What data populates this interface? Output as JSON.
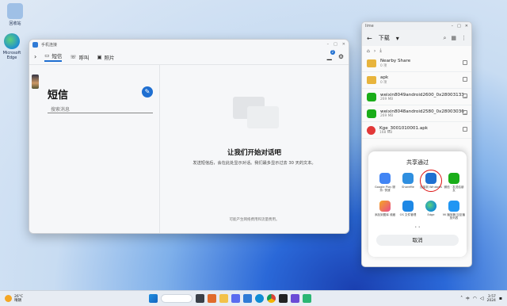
{
  "desktop": {
    "icons": [
      {
        "label": "回收站",
        "color": "#7da7d9"
      },
      {
        "label": "Microsoft Edge",
        "color": "#1f8fd0"
      }
    ]
  },
  "phone_link": {
    "title": "手机连接",
    "tabs": [
      {
        "label": "短信",
        "icon": "message-icon"
      },
      {
        "label": "呼叫",
        "icon": "phone-icon"
      },
      {
        "label": "照片",
        "icon": "photo-icon"
      }
    ],
    "badge_count": "2",
    "messages_title": "短信",
    "compose_icon": "compose-icon",
    "search_placeholder": "搜索消息",
    "empty_title": "让我们开始对话吧",
    "empty_desc": "发送短信后，会在此处显示对话。我们最多显示过去 30 天的文本。",
    "footer_note": "可能产生网络费用和流量费用。"
  },
  "file_manager": {
    "window_title": "lime",
    "folder": "下载",
    "items": [
      {
        "name": "Nearby Share",
        "meta": "0 项",
        "type": "folder"
      },
      {
        "name": "apk",
        "meta": "0 项",
        "type": "folder"
      },
      {
        "name": "weixin8049android2600_0x28003133_arm64.apk",
        "meta": "269 MB",
        "type": "wechat"
      },
      {
        "name": "weixin8048android2580_0x28003036_arm64.apk",
        "meta": "269 MB",
        "type": "wechat"
      },
      {
        "name": "Kge_3001010001.apk",
        "meta": "168 MB",
        "type": "kge"
      }
    ]
  },
  "share_sheet": {
    "title": "共享通过",
    "apps": [
      {
        "label": "Google Play 服务: 快速",
        "color": "#4285f4"
      },
      {
        "label": "ShareMe",
        "color": "#2f8fe0"
      },
      {
        "label": "连接到 Windows",
        "color": "#1f6fd1"
      },
      {
        "label": "微信 · 发送给朋友",
        "color": "#1aad19"
      },
      {
        "label": "添加到图库 收藏",
        "color": "#f5a623"
      },
      {
        "label": "OS 文件管理",
        "color": "#1e88e5"
      },
      {
        "label": "Edge",
        "color": "#0f8cd4"
      },
      {
        "label": "Mi 播放器 加至播放列表",
        "color": "#2196f3"
      }
    ],
    "pager": "• •",
    "cancel": "取消"
  },
  "taskbar": {
    "weather_temp": "26°C",
    "weather_desc": "晴朗",
    "input_method": "中",
    "time": "3:57",
    "date": "2024"
  }
}
